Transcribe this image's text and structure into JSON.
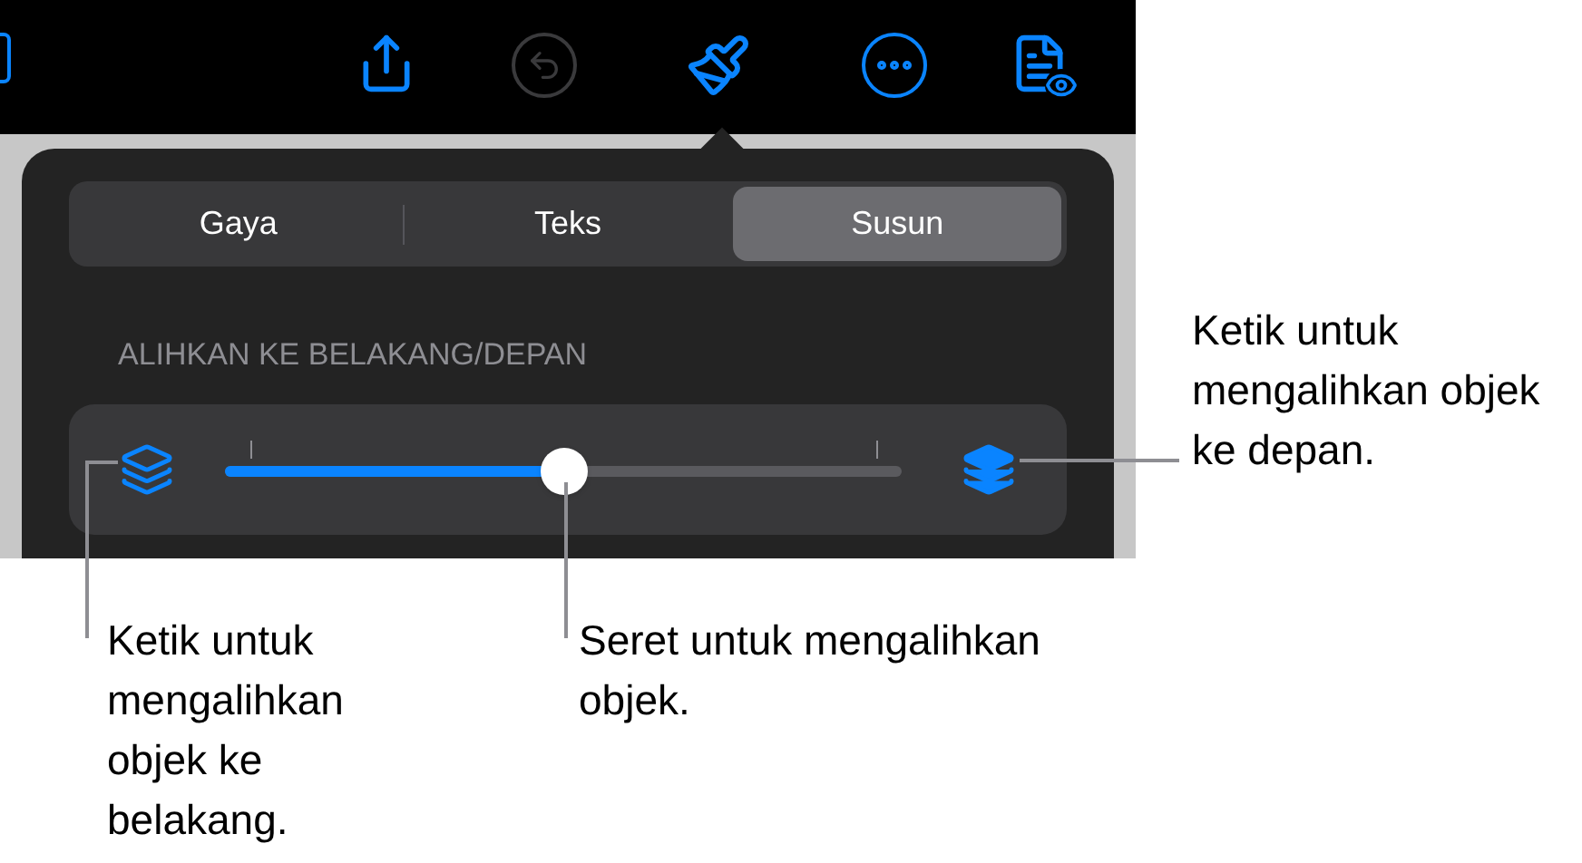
{
  "toolbar": [
    {
      "kind": "partial",
      "disabled": false
    },
    {
      "kind": "share",
      "disabled": false
    },
    {
      "kind": "undo",
      "disabled": true
    },
    {
      "kind": "brush",
      "disabled": false
    },
    {
      "kind": "more",
      "disabled": false
    },
    {
      "kind": "view",
      "disabled": false
    }
  ],
  "tabs": [
    {
      "label": "Gaya",
      "selected": false
    },
    {
      "label": "Teks",
      "selected": false
    },
    {
      "label": "Susun",
      "selected": true
    }
  ],
  "section_header": "ALIHKAN KE BELAKANG/DEPAN",
  "slider": {
    "level": 0.5
  },
  "callouts": [
    {
      "kind": "right",
      "text": "Ketik untuk mengalihkan objek ke depan."
    },
    {
      "kind": "left",
      "text": "Ketik untuk mengalihkan objek ke belakang."
    },
    {
      "kind": "middle",
      "text": "Seret untuk mengalihkan objek."
    }
  ]
}
